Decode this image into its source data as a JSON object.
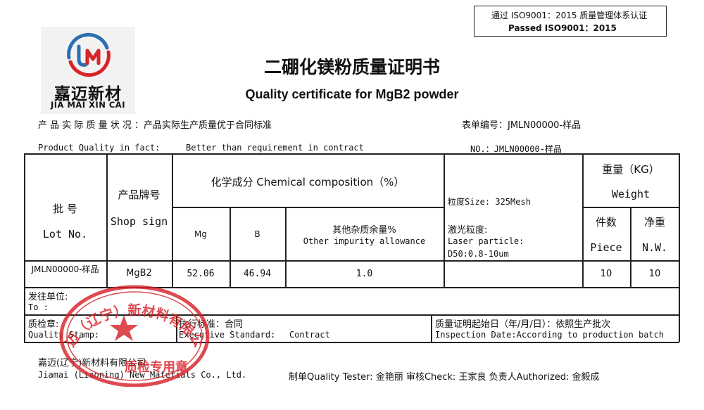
{
  "iso_box": {
    "line1": "通过 ISO9001：2015 质量管理体系认证",
    "line2": "Passed    ISO9001：2015"
  },
  "logo": {
    "cn": "嘉迈新材",
    "en": "JIA MAI XIN CAI"
  },
  "title": {
    "cn": "二硼化镁粉质量证明书",
    "en": "Quality certificate for MgB2 powder"
  },
  "meta": {
    "quality_cn": "产 品 实 际 质 量 状 况 ：产品实际生产质量优于合同标准",
    "form_no_cn": "表单编号：JMLN00000-样品",
    "quality_en_label": "Product Quality in fact:",
    "quality_en_value": "Better than requirement in contract",
    "no_en": "NO.：JMLN00000-样品"
  },
  "table": {
    "lot": {
      "cn": "批    号",
      "en": "Lot No."
    },
    "shop_sign": {
      "cn": "产品牌号",
      "en": "Shop sign"
    },
    "chem": {
      "header": "化学成分 Chemical composition（%）",
      "mg": "Mg",
      "b": "B",
      "other_cn": "其他杂质余量%",
      "other_en": "Other impurity allowance"
    },
    "size": {
      "line1": "粒度Size: 325Mesh",
      "line2": "激光粒度:",
      "line3": "Laser particle:",
      "line4": "D50:0.8-10um"
    },
    "weight": {
      "cn": "重量（KG）",
      "en": "Weight",
      "piece_cn": "件数",
      "piece_en": "Piece",
      "nw_cn": "净重",
      "nw_en": "N.W."
    },
    "row": {
      "lot": "JMLN00000-样品",
      "shop_sign": "MgB2",
      "mg": "52.06",
      "b": "46.94",
      "other": "1.0",
      "piece": "10",
      "nw": "10"
    }
  },
  "consignee": {
    "cn": "发往单位:",
    "en": "To :"
  },
  "stamp_row": {
    "qc_cn": "质检章:",
    "qc_en": "Quality Stamp:",
    "std_cn": "执行标准：合同",
    "std_en_label": "Executive Standard:",
    "std_en_value": "Contract",
    "date_cn": "质量证明起始日（年/月/日）：依照生产批次",
    "date_en": "Inspection Date:According to production batch"
  },
  "company": {
    "cn": "嘉迈(辽宁)新材料有限公司",
    "en": "Jiamai (Liaoning) New Materials Co., Ltd."
  },
  "signatures": "制单Quality Tester: 金艳丽  审核Check: 王家良  负责人Authorized: 金毅成",
  "stamp": {
    "ring_text": "嘉迈（辽宁）新材料有限公司",
    "center_text": "质检专用章",
    "color": "#d8232a"
  }
}
